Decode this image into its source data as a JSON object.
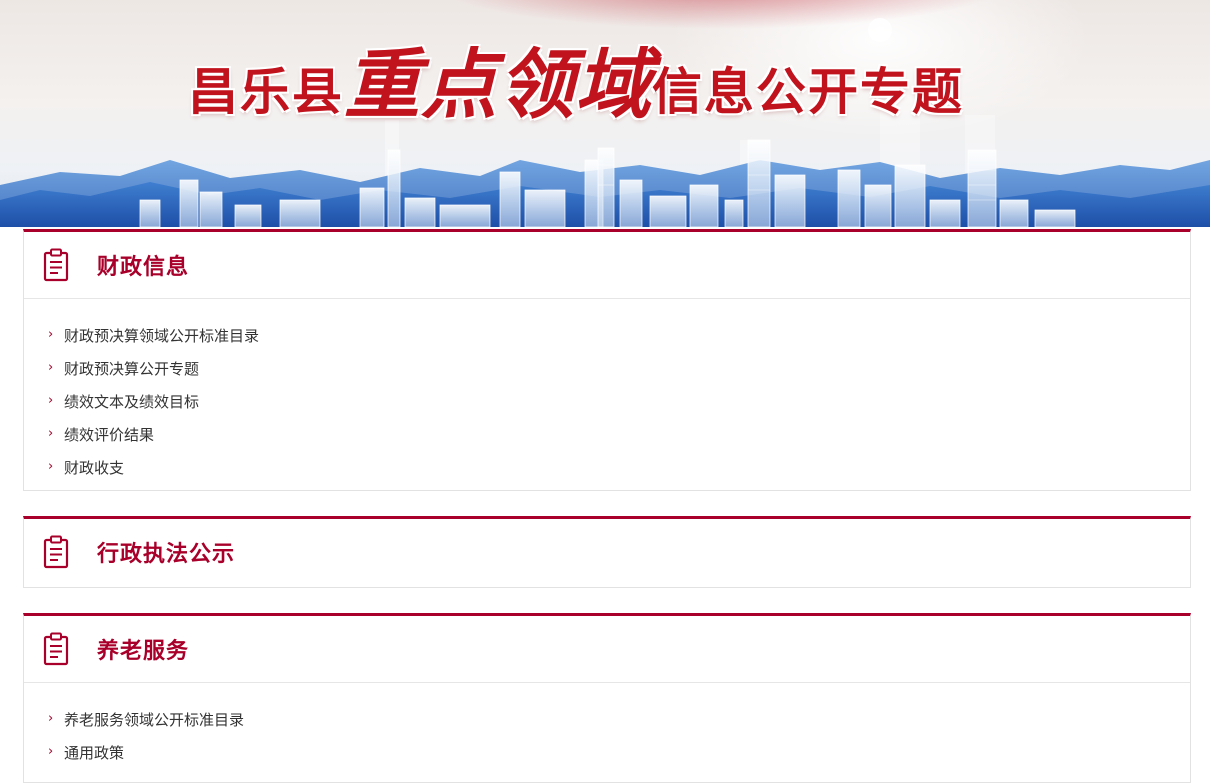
{
  "banner": {
    "title_part1": "昌乐县",
    "title_part2": "重点领域",
    "title_part3": "信息公开专题"
  },
  "sections": [
    {
      "title": "财政信息",
      "icon": "clipboard-icon",
      "items": [
        {
          "label": "财政预决算领域公开标准目录"
        },
        {
          "label": "财政预决算公开专题"
        },
        {
          "label": "绩效文本及绩效目标"
        },
        {
          "label": "绩效评价结果"
        },
        {
          "label": "财政收支"
        }
      ]
    },
    {
      "title": "行政执法公示",
      "icon": "clipboard-icon",
      "items": []
    },
    {
      "title": "养老服务",
      "icon": "clipboard-icon",
      "items": [
        {
          "label": "养老服务领域公开标准目录"
        },
        {
          "label": "通用政策"
        }
      ]
    }
  ],
  "colors": {
    "accent": "#a8002a",
    "banner_title": "#c1131e",
    "text": "#333333",
    "border": "#e2e2e2"
  }
}
